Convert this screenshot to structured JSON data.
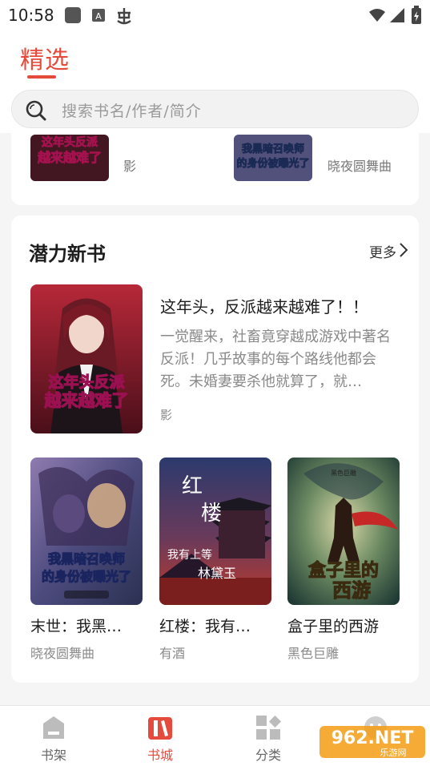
{
  "status_bar": {
    "time": "10:58"
  },
  "header": {
    "active_tab": "精选"
  },
  "search": {
    "placeholder": "搜索书名/作者/简介"
  },
  "top_strip": {
    "items": [
      {
        "author": "影"
      },
      {
        "author": "晓夜圆舞曲"
      }
    ]
  },
  "section": {
    "title": "潜力新书",
    "more_label": "更多",
    "featured": {
      "title": "这年头，反派越来越难了！！",
      "description": "一觉醒来，社畜竟穿越成游戏中著名反派！几乎故事的每个路线他都会死。未婚妻要杀他就算了，就…",
      "author": "影"
    },
    "books": [
      {
        "title": "末世：我黑…",
        "author": "晓夜圆舞曲"
      },
      {
        "title": "红楼：我有…",
        "author": "有酒"
      },
      {
        "title": "盒子里的西游",
        "author": "黑色巨雕"
      }
    ]
  },
  "bottom_nav": [
    {
      "label": "书架",
      "icon": "bookshelf-icon",
      "active": false
    },
    {
      "label": "书城",
      "icon": "bookstore-icon",
      "active": true
    },
    {
      "label": "分类",
      "icon": "category-icon",
      "active": false
    },
    {
      "label": "",
      "icon": "profile-icon",
      "active": false
    }
  ],
  "watermark": {
    "brand": "962.NET",
    "sub": "乐游网"
  },
  "colors": {
    "accent": "#e54b3c",
    "background": "#f5f5f5"
  }
}
